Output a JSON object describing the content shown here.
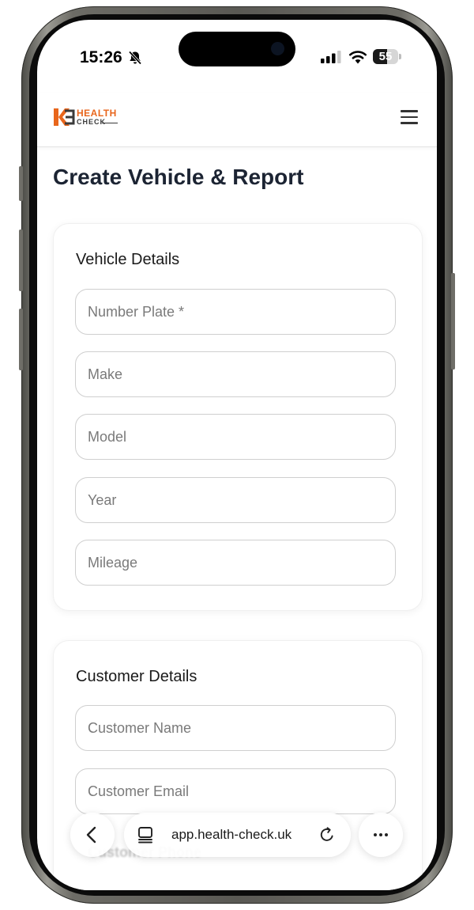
{
  "status_bar": {
    "time": "15:26",
    "battery_level": "55",
    "icons": [
      "bell-slash-icon",
      "cellular-signal-icon",
      "wifi-icon",
      "battery-icon"
    ]
  },
  "header": {
    "logo_line1": "HEALTH",
    "logo_line2": "CHECK",
    "menu_icon": "hamburger-menu-icon"
  },
  "page": {
    "title": "Create Vehicle & Report"
  },
  "vehicle_details": {
    "title": "Vehicle Details",
    "fields": [
      {
        "placeholder": "Number Plate *"
      },
      {
        "placeholder": "Make"
      },
      {
        "placeholder": "Model"
      },
      {
        "placeholder": "Year"
      },
      {
        "placeholder": "Mileage"
      }
    ]
  },
  "customer_details": {
    "title": "Customer Details",
    "fields": [
      {
        "placeholder": "Customer Name"
      },
      {
        "placeholder": "Customer Email"
      }
    ],
    "obscured_field_text": "Customer Phone"
  },
  "browser_bar": {
    "url": "app.health-check.uk",
    "back_icon": "chevron-left-icon",
    "tabs_icon": "tabs-icon",
    "reload_icon": "reload-icon",
    "more_icon": "ellipsis-icon"
  },
  "colors": {
    "brand_orange": "#e8661c",
    "title_dark": "#1c2433",
    "field_border": "#cfcfcf",
    "placeholder_gray": "#7a7a7a"
  }
}
